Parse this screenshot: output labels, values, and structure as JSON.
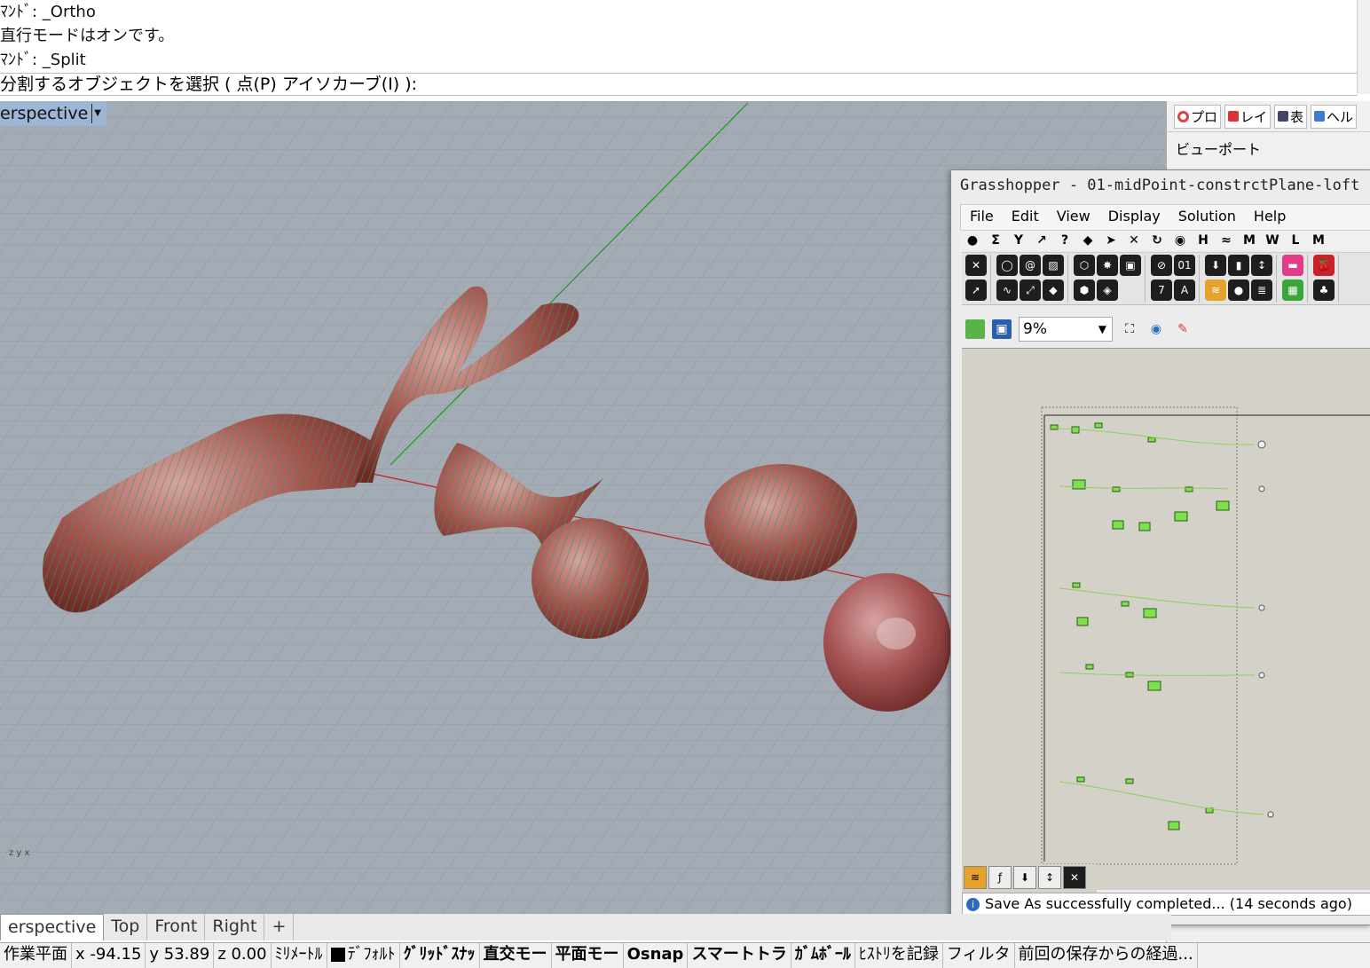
{
  "command_history": {
    "lines": [
      "ﾏﾝﾄﾞ: _Ortho",
      "直行モードはオンです。",
      "ﾏﾝﾄﾞ: _Split"
    ],
    "prompt": "分割するオブジェクトを選択 (",
    "option_point": "点(P)",
    "option_isocurve": "アイソカーブ(I)",
    "prompt_end": "):"
  },
  "viewport": {
    "title": "erspective",
    "axes_label": "z y x"
  },
  "props_panel": {
    "tabs": [
      "プロ",
      "レイ",
      "表",
      "ヘル"
    ],
    "header": "ビューポート"
  },
  "grasshopper": {
    "title": "Grasshopper - 01-midPoint-constrctPlane-loft",
    "menu": [
      "File",
      "Edit",
      "View",
      "Display",
      "Solution",
      "Help"
    ],
    "category_tabs": [
      "●",
      "Σ",
      "Y",
      "↗",
      "?",
      "◆",
      "➤",
      "✕",
      "↻",
      "◉",
      "H",
      "≈",
      "M",
      "W",
      "L",
      "M"
    ],
    "zoom": "9%",
    "status": "Save As successfully completed... (14 seconds ago)"
  },
  "viewport_tabs": [
    "erspective",
    "Top",
    "Front",
    "Right",
    "+"
  ],
  "statusbar": {
    "cplane": "作業平面",
    "x": "x -94.15",
    "y": "y 53.89",
    "z": "z 0.00",
    "units": "ﾐﾘﾒｰﾄﾙ",
    "layer": "ﾃﾞﾌｫﾙﾄ",
    "grid_snap": "ｸﾞﾘｯﾄﾞｽﾅｯ",
    "ortho": "直交モー",
    "planar": "平面モー",
    "osnap": "Osnap",
    "smarttrack": "スマートトラ",
    "gumball": "ｶﾞﾑﾎﾞｰﾙ",
    "history": "ﾋｽﾄﾘを記録",
    "filter": "フィルタ",
    "elapsed": "前回の保存からの経過..."
  }
}
